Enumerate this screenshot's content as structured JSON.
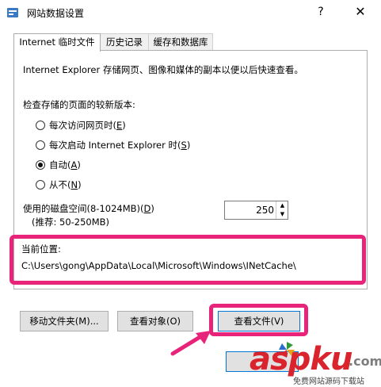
{
  "window": {
    "title": "网站数据设置",
    "help_glyph": "?",
    "close_glyph": "✕"
  },
  "tabs": [
    {
      "label": "Internet 临时文件"
    },
    {
      "label": "历史记录"
    },
    {
      "label": "缓存和数据库"
    }
  ],
  "temp": {
    "description": "Internet Explorer 存储网页、图像和媒体的副本以便以后快速查看。",
    "check_heading": "检查存储的页面的较新版本:",
    "options": [
      {
        "label": "每次访问网页时(",
        "key": "E",
        "end": ")",
        "selected": false
      },
      {
        "label": "每次启动 Internet Explorer 时(",
        "key": "S",
        "end": ")",
        "selected": false
      },
      {
        "label": "自动(",
        "key": "A",
        "end": ")",
        "selected": true
      },
      {
        "label": "从不(",
        "key": "N",
        "end": ")",
        "selected": false
      }
    ],
    "disk_label": "使用的磁盘空间(8-1024MB)(",
    "disk_key": "D",
    "disk_end": ")",
    "disk_recommend": "(推荐: 50-250MB)",
    "disk_value": "250",
    "location_label": "当前位置:",
    "location_path": "C:\\Users\\gong\\AppData\\Local\\Microsoft\\Windows\\INetCache\\"
  },
  "buttons": {
    "move_folder": "移动文件夹(M)...",
    "view_objects": "查看对象(O)",
    "view_files": "查看文件(V)"
  },
  "watermark": {
    "brand": "aspku",
    "tld": ".com",
    "slogan": "免费网站源码下载站"
  },
  "colors": {
    "highlight": "#e8247a",
    "watermark_red": "#d9232d"
  }
}
